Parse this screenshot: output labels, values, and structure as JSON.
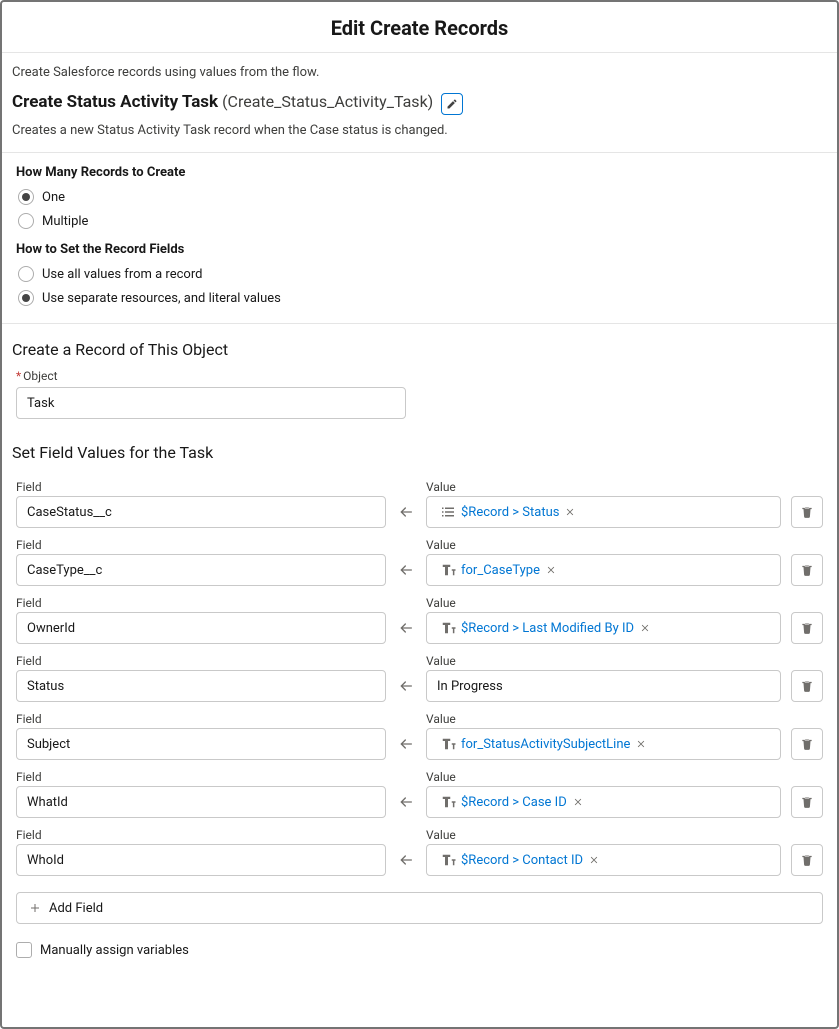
{
  "title": "Edit Create Records",
  "intro": "Create Salesforce records using values from the flow.",
  "element": {
    "label": "Create Status Activity Task",
    "api_name": "(Create_Status_Activity_Task)",
    "description": "Creates a new Status Activity Task record when the Case status is changed."
  },
  "how_many": {
    "label": "How Many Records to Create",
    "options": [
      "One",
      "Multiple"
    ],
    "selected": "One"
  },
  "how_set": {
    "label": "How to Set the Record Fields",
    "options": [
      "Use all values from a record",
      "Use separate resources, and literal values"
    ],
    "selected": "Use separate resources, and literal values"
  },
  "object_section_title": "Create a Record of This Object",
  "object_label": "Object",
  "object_value": "Task",
  "field_values_title": "Set Field Values for the Task",
  "field_header": "Field",
  "value_header": "Value",
  "add_field": "Add Field",
  "rows": [
    {
      "field": "CaseStatus__c",
      "value_text": "$Record > Status",
      "value_kind": "picklist",
      "literal": false
    },
    {
      "field": "CaseType__c",
      "value_text": "for_CaseType",
      "value_kind": "text",
      "literal": false
    },
    {
      "field": "OwnerId",
      "value_text": "$Record > Last Modified By ID",
      "value_kind": "text",
      "literal": false
    },
    {
      "field": "Status",
      "value_text": "In Progress",
      "value_kind": "plain",
      "literal": true
    },
    {
      "field": "Subject",
      "value_text": "for_StatusActivitySubjectLine",
      "value_kind": "text",
      "literal": false
    },
    {
      "field": "WhatId",
      "value_text": "$Record > Case ID",
      "value_kind": "text",
      "literal": false
    },
    {
      "field": "WhoId",
      "value_text": "$Record > Contact ID",
      "value_kind": "text",
      "literal": false
    }
  ],
  "manual_assign": "Manually assign variables"
}
